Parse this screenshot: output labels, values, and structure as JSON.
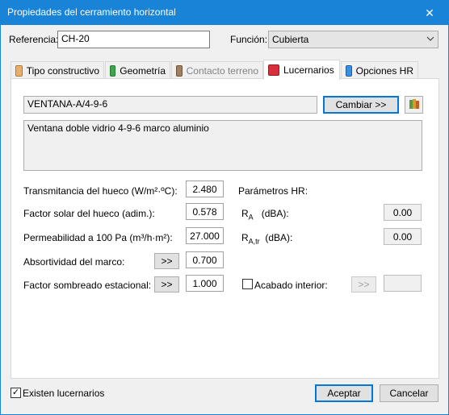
{
  "window": {
    "title": "Propiedades del cerramiento horizontal",
    "close_glyph": "✕"
  },
  "referencia": {
    "label": "Referencia:",
    "value": "CH-20"
  },
  "funcion": {
    "label": "Función:",
    "value": "Cubierta"
  },
  "tabs": [
    {
      "label": "Tipo constructivo",
      "icon": "wall-icon",
      "color": "#e8b06a"
    },
    {
      "label": "Geometría",
      "icon": "geometry-icon",
      "color": "#3aa84a"
    },
    {
      "label": "Contacto terreno",
      "icon": "ground-icon",
      "color": "#a08060"
    },
    {
      "label": "Lucernarios",
      "icon": "skylight-icon",
      "color": "#d8303a"
    },
    {
      "label": "Opciones HR",
      "icon": "music-note-icon",
      "color": "#3c8ee0"
    }
  ],
  "lucernario": {
    "window_type": "VENTANA-A/4-9-6",
    "description": "Ventana doble vidrio 4-9-6 marco aluminio",
    "change_button": "Cambiar >>",
    "library_icon": "library-icon"
  },
  "fields": {
    "transmitancia": {
      "label": "Transmitancia del hueco (W/m²·ºC):",
      "value": "2.480"
    },
    "factor_solar": {
      "label": "Factor solar del hueco (adim.):",
      "value": "0.578"
    },
    "permeabilidad": {
      "label": "Permeabilidad a 100 Pa (m³/h·m²):",
      "value": "27.000"
    },
    "absortividad": {
      "label": "Absortividad del marco:",
      "value": "0.700",
      "button": ">>"
    },
    "sombreado": {
      "label": "Factor sombreado estacional:",
      "value": "1.000",
      "button": ">>"
    }
  },
  "hr": {
    "title": "Parámetros HR:",
    "ra_label_main": "R",
    "ra_label_sub": "A",
    "ra_unit": "(dBA):",
    "ra_value": "0.00",
    "ratr_label_main": "R",
    "ratr_label_sub": "A,tr",
    "ratr_unit": "(dBA):",
    "ratr_value": "0.00",
    "acabado_label": "Acabado interior:",
    "acabado_button": ">>",
    "acabado_value": ""
  },
  "footer": {
    "checkbox_label": "Existen lucernarios",
    "checkbox_checked": "✓",
    "accept_button": "Aceptar",
    "cancel_button": "Cancelar"
  }
}
